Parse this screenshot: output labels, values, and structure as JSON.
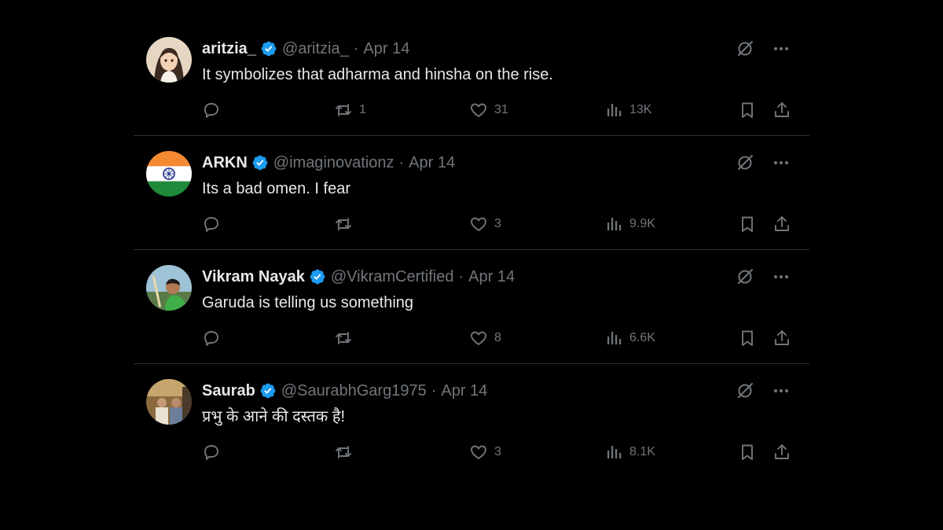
{
  "colors": {
    "background": "#000000",
    "text": "#e7e9ea",
    "secondary": "#71767b",
    "divider": "#2f3336",
    "verified": "#1d9bf0"
  },
  "tweets": [
    {
      "name": "aritzia_",
      "handle": "@aritzia_",
      "separator": "·",
      "date": "Apr 14",
      "text": "It symbolizes that adharma and hinsha on the rise.",
      "retweets": "1",
      "likes": "31",
      "views": "13K"
    },
    {
      "name": "ARKN",
      "handle": "@imaginovationz",
      "separator": "·",
      "date": "Apr 14",
      "text": "Its a bad omen. I fear",
      "retweets": "",
      "likes": "3",
      "views": "9.9K"
    },
    {
      "name": "Vikram Nayak",
      "handle": "@VikramCertified",
      "separator": "·",
      "date": "Apr 14",
      "text": "Garuda is telling us something",
      "retweets": "",
      "likes": "8",
      "views": "6.6K"
    },
    {
      "name": "Saurab",
      "handle": "@SaurabhGarg1975",
      "separator": "·",
      "date": "Apr 14",
      "text": "प्रभु के आने की दस्तक है!",
      "retweets": "",
      "likes": "3",
      "views": "8.1K"
    }
  ],
  "icons": {
    "top": [
      "grok-icon",
      "more-icon"
    ],
    "actions": [
      "reply-icon",
      "retweet-icon",
      "like-icon",
      "views-icon",
      "bookmark-icon",
      "share-icon"
    ]
  }
}
